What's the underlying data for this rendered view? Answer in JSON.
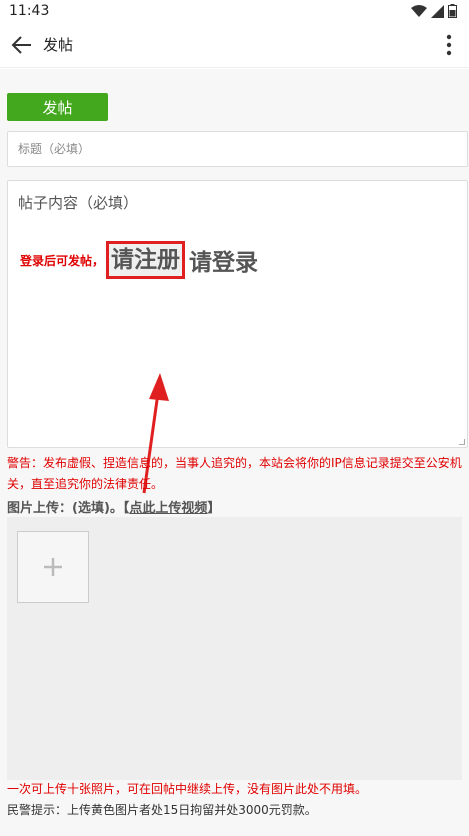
{
  "status_bar": {
    "time": "11:43"
  },
  "app_bar": {
    "title": "发帖"
  },
  "form": {
    "post_button_label": "发帖",
    "title_placeholder": "标题（必填）",
    "content_placeholder": "帖子内容（必填）",
    "login_prefix": "登录后可发帖，",
    "register_link": "请注册",
    "login_link": "请登录"
  },
  "warning_text": "警告：发布虚假、捏造信息的，当事人追究的，本站会将你的IP信息记录提交至公安机关，直至追究你的法律责任。",
  "upload": {
    "label": "图片上传：(选填)。【",
    "video_link": "点此上传视频",
    "label_suffix": "】"
  },
  "notes": {
    "limit": "一次可上传十张照片，可在回帖中继续上传，没有图片此处不用填。",
    "police": "民警提示：上传黄色图片者处15日拘留并处3000元罚款。"
  },
  "colors": {
    "accent_green": "#44a81e",
    "warning_red": "#e00000",
    "highlight_border": "#e02020"
  }
}
